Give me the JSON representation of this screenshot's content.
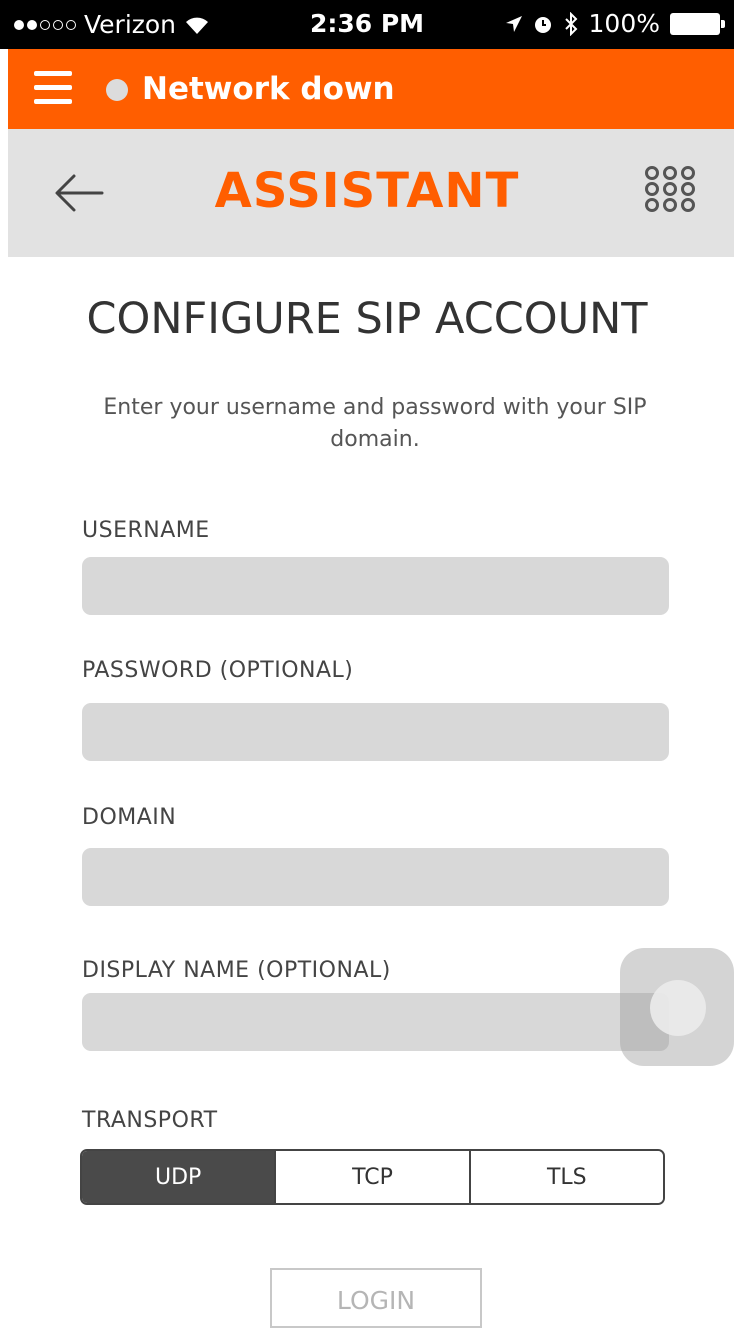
{
  "status_bar": {
    "carrier": "Verizon",
    "time": "2:36 PM",
    "battery": "100%"
  },
  "top_bar": {
    "network_status": "Network down",
    "accent_color": "#ff5e00"
  },
  "header": {
    "title": "ASSISTANT"
  },
  "page": {
    "title": "CONFIGURE SIP ACCOUNT",
    "instructions": "Enter your username and password with your SIP domain."
  },
  "form": {
    "username_label": "USERNAME",
    "username_value": "",
    "password_label": "PASSWORD (OPTIONAL)",
    "password_value": "",
    "domain_label": "DOMAIN",
    "domain_value": "",
    "display_name_label": "DISPLAY NAME (OPTIONAL)",
    "display_name_value": "",
    "transport_label": "TRANSPORT",
    "transport_options": [
      "UDP",
      "TCP",
      "TLS"
    ],
    "transport_selected": "UDP"
  },
  "actions": {
    "login_label": "LOGIN"
  }
}
